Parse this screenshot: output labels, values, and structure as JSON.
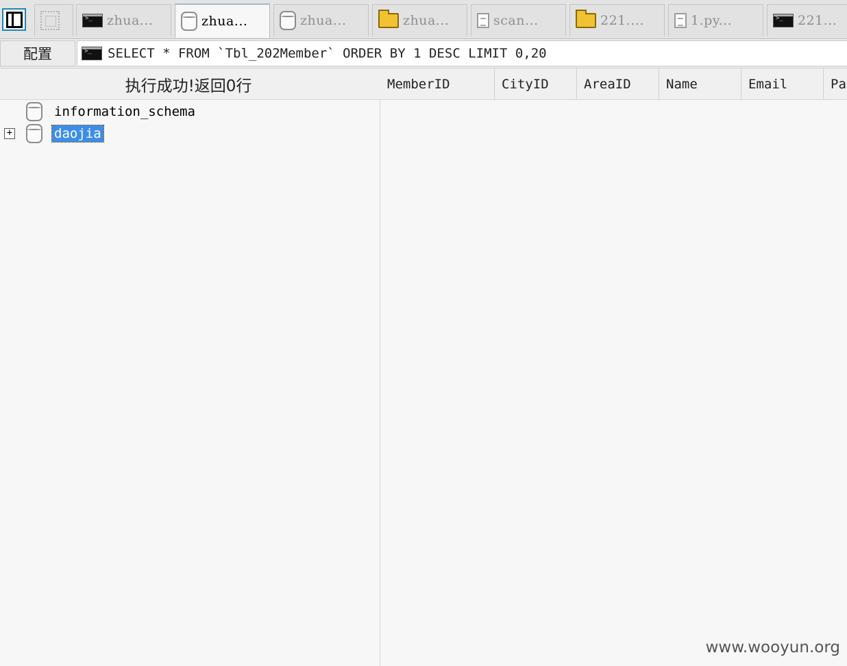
{
  "tabs": [
    {
      "label": "",
      "icon": "blank-icon"
    },
    {
      "label": "zhua...",
      "icon": "terminal-icon"
    },
    {
      "label": "zhua...",
      "icon": "database-icon",
      "active": true
    },
    {
      "label": "zhua...",
      "icon": "database-icon"
    },
    {
      "label": "zhua...",
      "icon": "folder-icon"
    },
    {
      "label": "scan...",
      "icon": "file-icon"
    },
    {
      "label": "221....",
      "icon": "folder-icon"
    },
    {
      "label": "1.py...",
      "icon": "file-icon"
    },
    {
      "label": "221...",
      "icon": "terminal-icon"
    }
  ],
  "querybar": {
    "config_label": "配置",
    "sql": "SELECT * FROM `Tbl_202Member` ORDER BY 1 DESC LIMIT 0,20"
  },
  "status": {
    "message": "执行成功!返回0行"
  },
  "columns": [
    "MemberID",
    "CityID",
    "AreaID",
    "Name",
    "Email",
    "Pa"
  ],
  "tree": [
    {
      "label": "information_schema",
      "expandable": false,
      "selected": false
    },
    {
      "label": "daojia",
      "expandable": true,
      "selected": true
    }
  ],
  "watermark": "www.wooyun.org"
}
